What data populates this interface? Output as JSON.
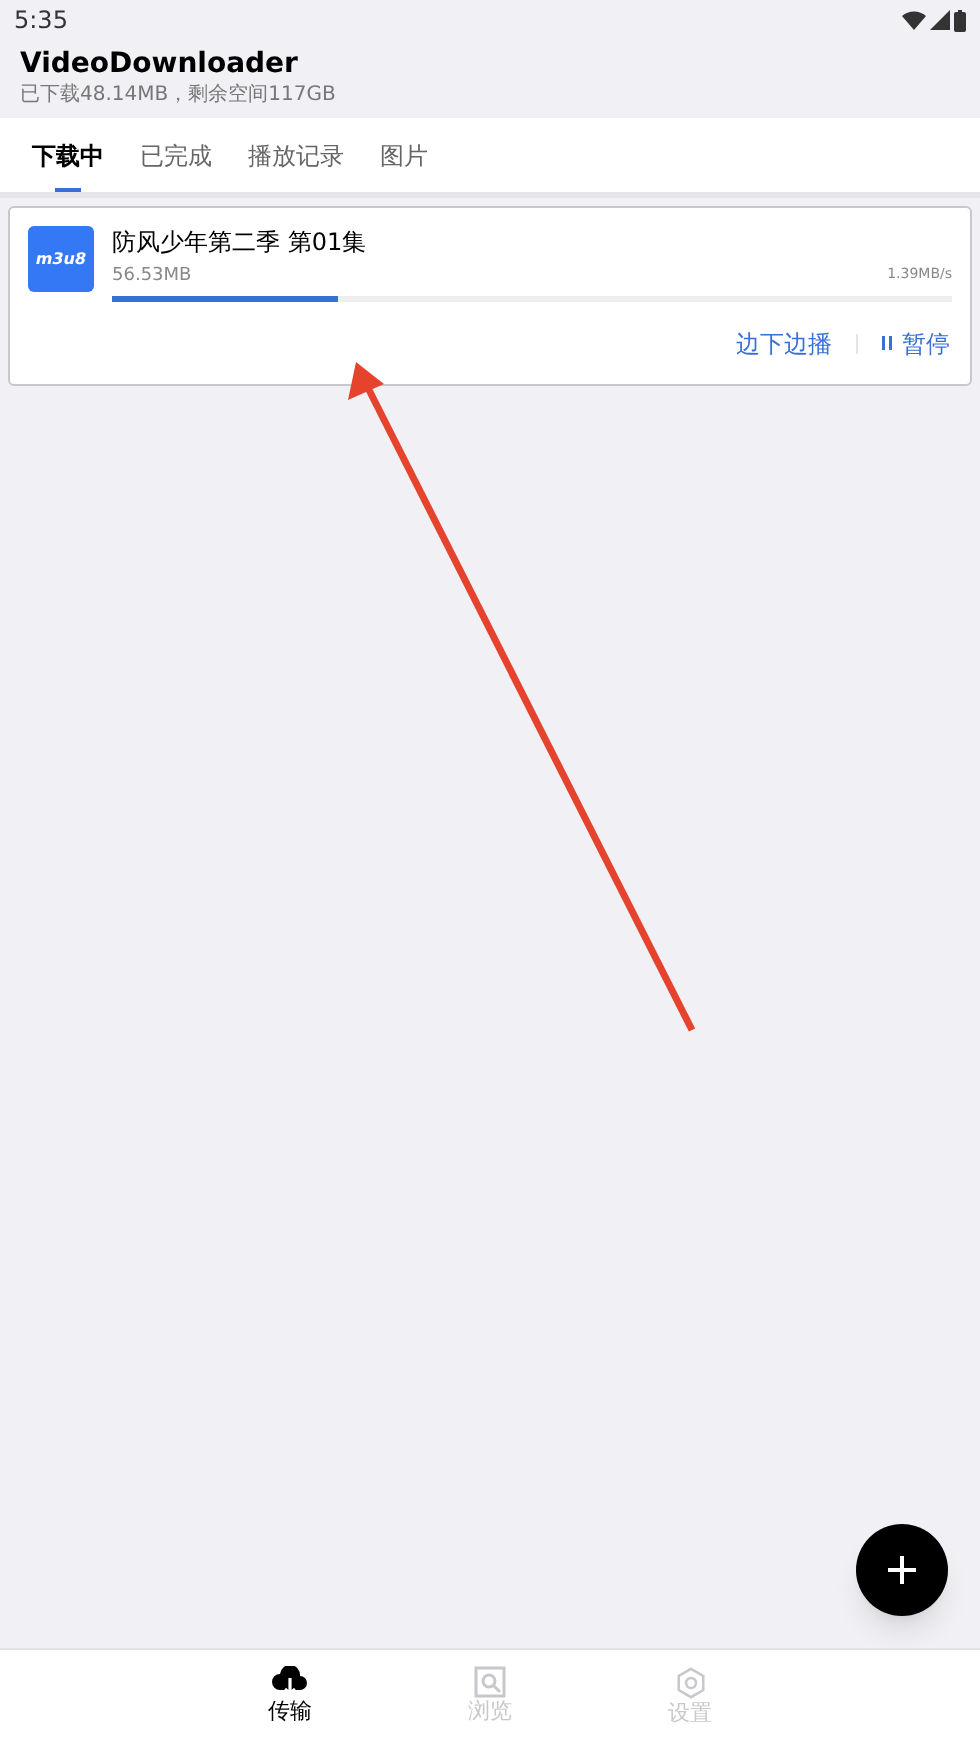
{
  "status_bar": {
    "time": "5:35"
  },
  "header": {
    "title": "VideoDownloader",
    "subtitle": "已下载48.14MB，剩余空间117GB"
  },
  "tabs": [
    {
      "label": "下载中",
      "selected": true
    },
    {
      "label": "已完成",
      "selected": false
    },
    {
      "label": "播放记录",
      "selected": false
    },
    {
      "label": "图片",
      "selected": false
    }
  ],
  "downloads": [
    {
      "badge": "m3u8",
      "title": "防风少年第二季 第01集",
      "size": "56.53MB",
      "speed": "1.39MB/s",
      "level": 0.27,
      "actions": [
        "边下边播",
        "暂停"
      ]
    }
  ],
  "bottom_nav": [
    {
      "label": "传输",
      "kind": "transfer",
      "selected": true
    },
    {
      "label": "浏览",
      "kind": "browse",
      "selected": false
    },
    {
      "label": "设置",
      "kind": "settings",
      "selected": false
    }
  ]
}
